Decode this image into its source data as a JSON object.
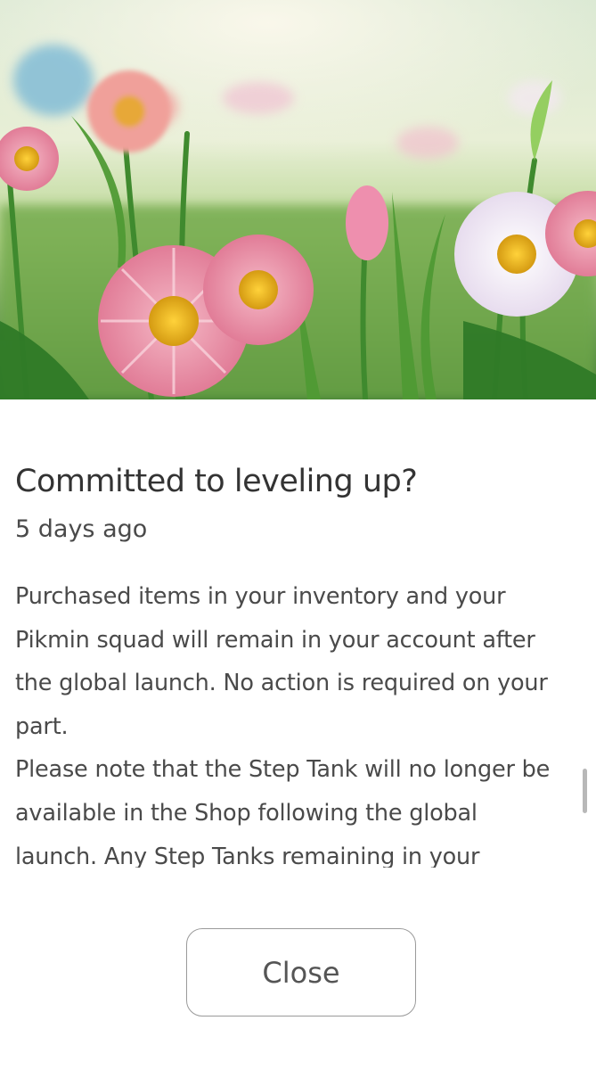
{
  "dialog": {
    "hero_image": "meadow-flowers-image",
    "title": "Committed to leveling up?",
    "date": "5 days ago",
    "body": "Purchased items in your inventory and your\nPikmin squad will remain in your account after\nthe global launch.  No action is required on your\npart.\nPlease note that the Step Tank will no longer be\navailable in the Shop following the global\nlaunch.  Any Step Tanks remaining in your",
    "close_label": "Close"
  }
}
